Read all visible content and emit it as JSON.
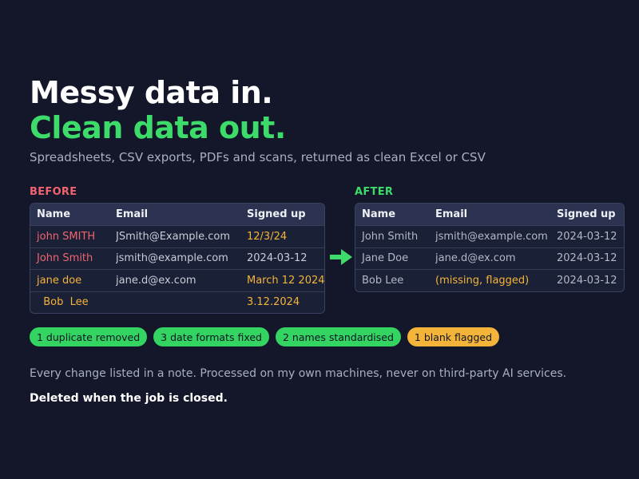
{
  "headline": {
    "line1": "Messy data in.",
    "line2": "Clean data out.",
    "subtitle": "Spreadsheets, CSV exports, PDFs and scans, returned as clean Excel or CSV"
  },
  "colors": {
    "background": "#131729",
    "accent_green": "#3ddc6a",
    "accent_red": "#f06470",
    "accent_yellow": "#f4b43a",
    "muted_text": "#a9aec0"
  },
  "before": {
    "label": "BEFORE",
    "headers": [
      "Name",
      "Email",
      "Signed up"
    ],
    "rows": [
      {
        "cells": [
          "john SMITH",
          "JSmith@Example.com",
          "12/3/24"
        ],
        "colors": [
          "#f06470",
          "#c9ccd8",
          "#f4b43a"
        ]
      },
      {
        "cells": [
          "John Smith",
          "jsmith@example.com",
          "2024-03-12"
        ],
        "colors": [
          "#f06470",
          "#c9ccd8",
          "#c9ccd8"
        ]
      },
      {
        "cells": [
          "jane doe",
          "jane.d@ex.com",
          "March 12 2024"
        ],
        "colors": [
          "#f4b43a",
          "#c9ccd8",
          "#f4b43a"
        ]
      },
      {
        "cells": [
          "  Bob  Lee",
          "",
          "3.12.2024"
        ],
        "colors": [
          "#f4b43a",
          "#c9ccd8",
          "#f4b43a"
        ]
      }
    ]
  },
  "after": {
    "label": "AFTER",
    "headers": [
      "Name",
      "Email",
      "Signed up"
    ],
    "rows": [
      {
        "cells": [
          "John Smith",
          "jsmith@example.com",
          "2024-03-12"
        ],
        "colors": [
          "#b3b8c8",
          "#b3b8c8",
          "#b3b8c8"
        ]
      },
      {
        "cells": [
          "Jane Doe",
          "jane.d@ex.com",
          "2024-03-12"
        ],
        "colors": [
          "#b3b8c8",
          "#b3b8c8",
          "#b3b8c8"
        ]
      },
      {
        "cells": [
          "Bob Lee",
          "(missing, flagged)",
          "2024-03-12"
        ],
        "colors": [
          "#b3b8c8",
          "#f4b43a",
          "#b3b8c8"
        ]
      }
    ]
  },
  "arrow_icon": "arrow-right-icon",
  "badges": [
    {
      "text": "1 duplicate removed",
      "color": "green"
    },
    {
      "text": "3 date formats fixed",
      "color": "green"
    },
    {
      "text": "2 names standardised",
      "color": "green"
    },
    {
      "text": "1 blank flagged",
      "color": "yellow"
    }
  ],
  "notes": {
    "line1": "Every change listed in a note. Processed on my own machines, never on third-party AI services.",
    "line2": "Deleted when the job is closed."
  }
}
